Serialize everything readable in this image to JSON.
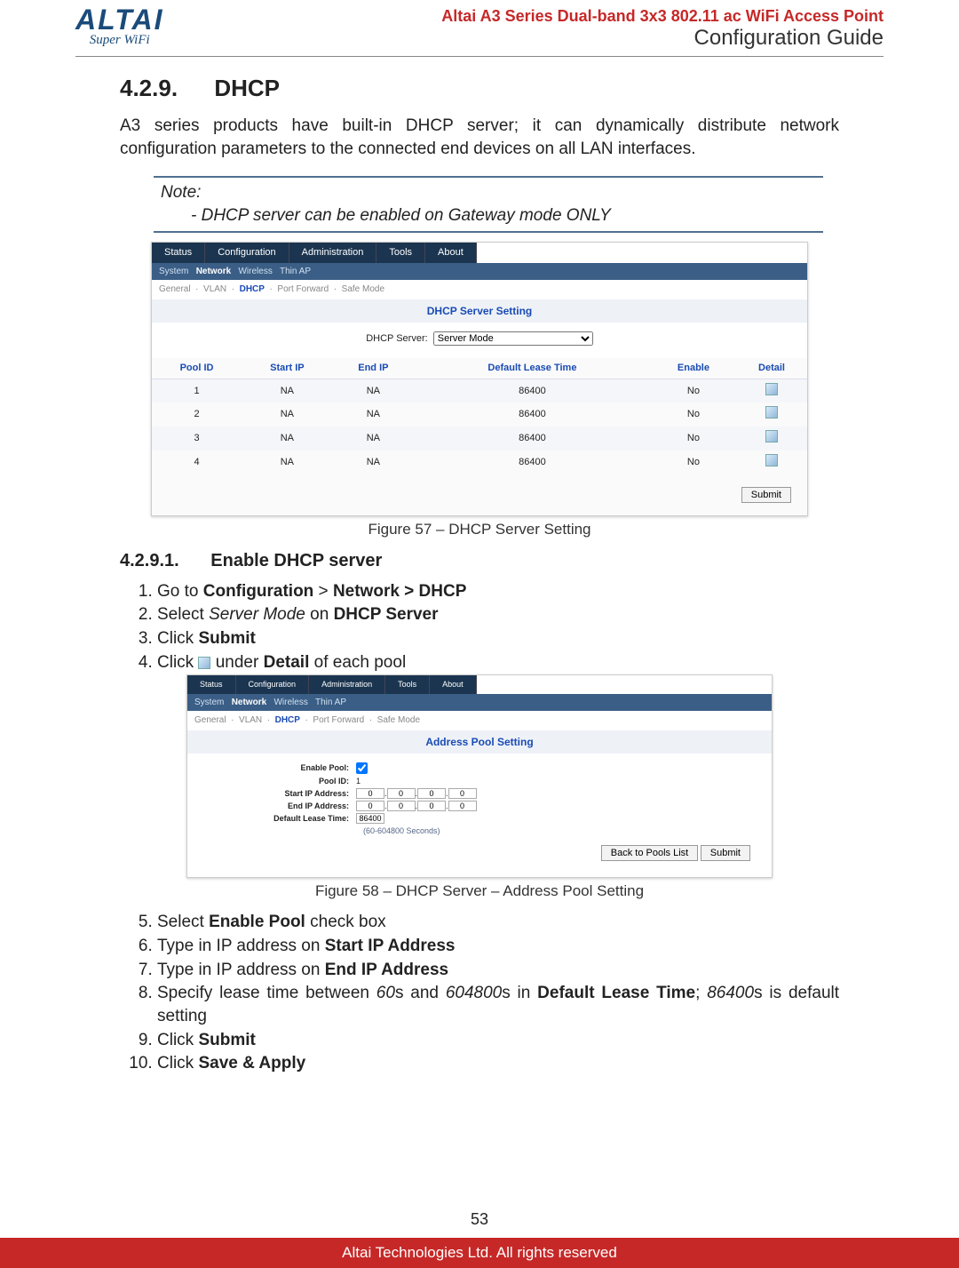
{
  "header": {
    "logo_main": "ALTAI",
    "logo_sub": "Super WiFi",
    "product": "Altai A3 Series Dual-band 3x3 802.11 ac WiFi Access Point",
    "guide": "Configuration Guide"
  },
  "section": {
    "number": "4.2.9.",
    "title": "DHCP",
    "intro": "A3 series products have built-in DHCP server; it can dynamically distribute network configuration parameters to the connected end devices on all LAN interfaces."
  },
  "note": {
    "label": "Note:",
    "bullet": "- DHCP server can be enabled on Gateway mode ONLY"
  },
  "shot1": {
    "tabs": {
      "t1": "Status",
      "t2": "Configuration",
      "t3": "Administration",
      "t4": "Tools",
      "t5": "About"
    },
    "sub": {
      "s1": "System",
      "s2": "Network",
      "s3": "Wireless",
      "s4": "Thin AP"
    },
    "crumb": {
      "c1": "General",
      "c2": "VLAN",
      "c3": "DHCP",
      "c4": "Port Forward",
      "c5": "Safe Mode"
    },
    "panel_title": "DHCP Server Setting",
    "server_label": "DHCP Server:",
    "server_value": "Server Mode",
    "th": {
      "pool": "Pool ID",
      "start": "Start IP",
      "end": "End IP",
      "lease": "Default Lease Time",
      "enable": "Enable",
      "detail": "Detail"
    },
    "rows": [
      {
        "id": "1",
        "start": "NA",
        "end": "NA",
        "lease": "86400",
        "enable": "No"
      },
      {
        "id": "2",
        "start": "NA",
        "end": "NA",
        "lease": "86400",
        "enable": "No"
      },
      {
        "id": "3",
        "start": "NA",
        "end": "NA",
        "lease": "86400",
        "enable": "No"
      },
      {
        "id": "4",
        "start": "NA",
        "end": "NA",
        "lease": "86400",
        "enable": "No"
      }
    ],
    "submit": "Submit"
  },
  "fig1": "Figure 57 – DHCP Server Setting",
  "subsection": {
    "number": "4.2.9.1.",
    "title": "Enable DHCP server"
  },
  "steps_a": {
    "s1a": "Go to ",
    "s1b": "Configuration",
    "s1c": " > ",
    "s1d": "Network > DHCP",
    "s2a": "Select ",
    "s2b": "Server Mode",
    "s2c": " on ",
    "s2d": "DHCP Server",
    "s3a": "Click ",
    "s3b": "Submit",
    "s4a": "Click ",
    "s4b": " under ",
    "s4c": "Detail",
    "s4d": " of each pool"
  },
  "shot2": {
    "panel_title": "Address Pool Setting",
    "enable_pool": "Enable Pool:",
    "pool_id_lbl": "Pool ID:",
    "pool_id_val": "1",
    "start_lbl": "Start IP Address:",
    "end_lbl": "End IP Address:",
    "lease_lbl": "Default Lease Time:",
    "lease_val": "86400",
    "hint": "(60-604800 Seconds)",
    "ip": "0",
    "back": "Back to Pools List",
    "submit": "Submit"
  },
  "fig2": "Figure 58 – DHCP Server – Address Pool Setting",
  "steps_b": {
    "s5a": "Select ",
    "s5b": "Enable Pool",
    "s5c": " check box",
    "s6a": "Type in IP address on ",
    "s6b": "Start IP Address",
    "s7a": "Type in IP address on ",
    "s7b": "End IP Address",
    "s8a": "Specify lease time between ",
    "s8b": "60",
    "s8c": "s and ",
    "s8d": "604800",
    "s8e": "s in ",
    "s8f": "Default Lease Time",
    "s8g": "; ",
    "s8h": "86400",
    "s8i": "s is default setting",
    "s9a": "Click ",
    "s9b": "Submit",
    "s10a": "Click ",
    "s10b": "Save & Apply"
  },
  "page_number": "53",
  "footer": "Altai Technologies Ltd. All rights reserved"
}
